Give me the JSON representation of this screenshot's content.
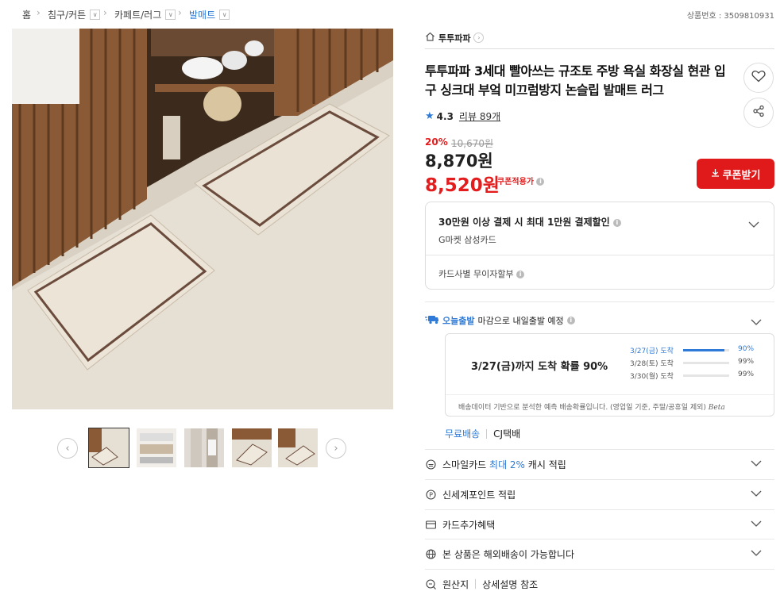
{
  "breadcrumb": {
    "items": [
      "홈",
      "침구/커튼",
      "카페트/러그",
      "발매트"
    ],
    "product_no": "상품번호 : 3509810931"
  },
  "brand": {
    "name": "투투파파"
  },
  "product": {
    "title": "투투파파 3세대 빨아쓰는 규조토 주방 욕실 화장실 현관 입구 싱크대 부엌 미끄럼방지 논슬립 발매트 러그",
    "rating": "4.3",
    "review_label": "리뷰 89개",
    "discount": "20%",
    "original_price": "10,670원",
    "price": "8,870원",
    "coupon_price": "8,520원",
    "coupon_applied_label": "쿠폰적용가",
    "coupon_button": "쿠폰받기"
  },
  "card_box": {
    "promo": "30만원 이상 결제 시 최대 1만원 결제할인",
    "card_name": "G마켓 삼성카드",
    "installment": "카드사별 무이자할부"
  },
  "shipping": {
    "badge": "오늘출발",
    "text": "마감으로 내일출발 예정",
    "prediction_main": "3/27(금)까지 도착 확률 90%",
    "rows": [
      {
        "date": "3/27(금) 도착",
        "pct": "90%",
        "value": 0.9,
        "highlight": true
      },
      {
        "date": "3/28(토) 도착",
        "pct": "99%",
        "value": 0.99,
        "highlight": false
      },
      {
        "date": "3/30(월) 도착",
        "pct": "99%",
        "value": 0.99,
        "highlight": false
      }
    ],
    "note": "배송데이터 기반으로 분석한 예측 배송확률입니다. (영업일 기준, 주말/공휴일 제외)",
    "beta": "Beta",
    "free_label": "무료배송",
    "courier": "CJ택배"
  },
  "accordion": {
    "smile_pre": "스마일카드",
    "smile_hl": "최대 2%",
    "smile_post": "캐시 적립",
    "shinsegae": "신세계포인트 적립",
    "card_benefit": "카드추가혜택",
    "overseas": "본 상품은 해외배송이 가능합니다",
    "origin_label": "원산지",
    "origin_value": "상세설명 참조"
  },
  "colors": {
    "accent_blue": "#2e7ad6",
    "sale_red": "#e31d1d"
  }
}
